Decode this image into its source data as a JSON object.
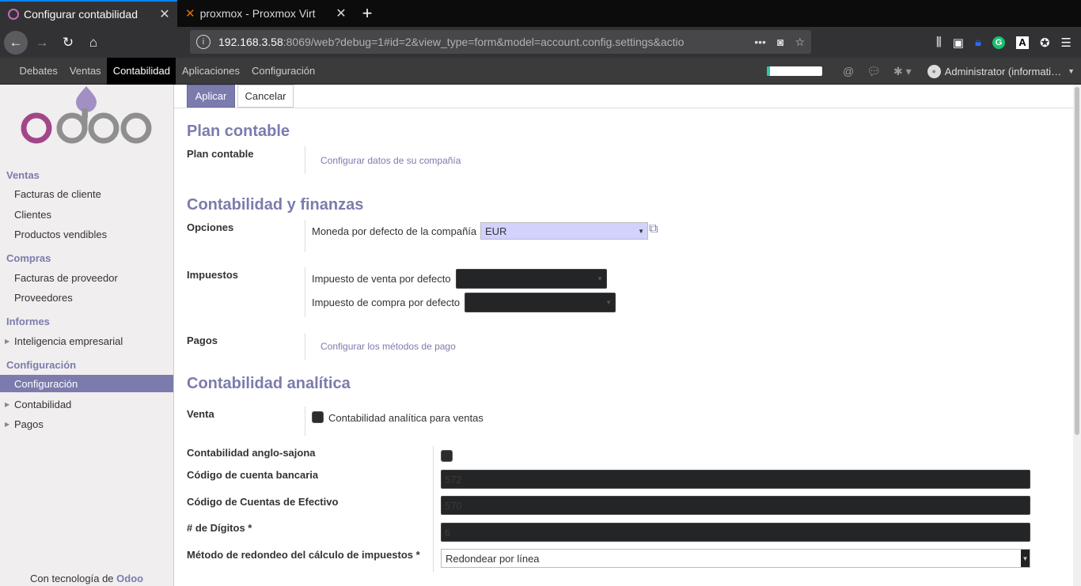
{
  "browser": {
    "tabs": [
      {
        "title": "Configurar contabilidad",
        "active": true
      },
      {
        "title": "proxmox - Proxmox Virt",
        "active": false
      }
    ],
    "url_host": "192.168.3.58",
    "url_rest": ":8069/web?debug=1#id=2&view_type=form&model=account.config.settings&actio",
    "url_dots": "•••",
    "icons": {
      "back": "back-arrow-icon",
      "forward": "forward-arrow-icon",
      "reload": "reload-icon",
      "home": "home-icon"
    }
  },
  "topmenu": {
    "items": [
      "Debates",
      "Ventas",
      "Contabilidad",
      "Aplicaciones",
      "Configuración"
    ],
    "active": "Contabilidad",
    "progress": 0.06,
    "progress_color": "#2fc4a4",
    "user": "Administrator (informati…"
  },
  "sidebar": {
    "sections": [
      {
        "title": "Ventas",
        "items": [
          "Facturas de cliente",
          "Clientes",
          "Productos vendibles"
        ]
      },
      {
        "title": "Compras",
        "items": [
          "Facturas de proveedor",
          "Proveedores"
        ]
      },
      {
        "title": "Informes",
        "items": [
          "Inteligencia empresarial"
        ]
      },
      {
        "title": "Configuración",
        "items": [
          "Configuración",
          "Contabilidad",
          "Pagos"
        ]
      }
    ],
    "selected": "Configuración",
    "powered_prefix": "Con tecnología de",
    "powered_brand": "Odoo"
  },
  "buttons": {
    "apply": "Aplicar",
    "cancel": "Cancelar"
  },
  "form": {
    "plan": {
      "heading": "Plan contable",
      "label": "Plan contable",
      "link": "Configurar datos de su compañía"
    },
    "finance": {
      "heading": "Contabilidad y finanzas",
      "options_label": "Opciones",
      "currency_label": "Moneda por defecto de la compañía",
      "currency_value": "EUR",
      "taxes_label": "Impuestos",
      "sale_tax_label": "Impuesto de venta por defecto",
      "purchase_tax_label": "Impuesto de compra por defecto",
      "payments_label": "Pagos",
      "payments_link": "Configurar los métodos de pago"
    },
    "analytic": {
      "heading": "Contabilidad analítica",
      "sale_label": "Venta",
      "sale_checkbox_label": "Contabilidad analítica para ventas"
    },
    "advanced": {
      "anglo_label": "Contabilidad anglo-sajona",
      "bank_code_label": "Código de cuenta bancaria",
      "bank_code_value": "572",
      "cash_code_label": "Código de Cuentas de Efectivo",
      "cash_code_value": "570",
      "digits_label": "# de Dígitos *",
      "digits_value": "6",
      "rounding_label": "Método de redondeo del cálculo de impuestos *",
      "rounding_value": "Redondear por línea"
    }
  }
}
